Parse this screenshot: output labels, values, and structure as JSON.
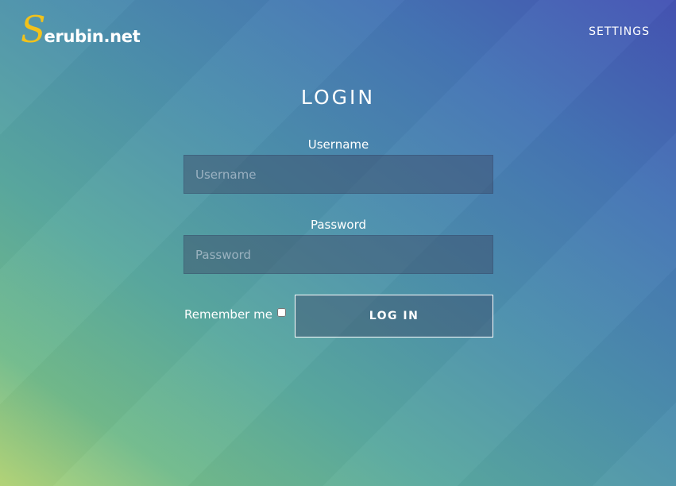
{
  "header": {
    "logo_initial": "S",
    "logo_rest": "erubin.net",
    "settings_label": "SETTINGS"
  },
  "login": {
    "title": "LOGIN",
    "username_label": "Username",
    "username_placeholder": "Username",
    "username_value": "",
    "password_label": "Password",
    "password_placeholder": "Password",
    "password_value": "",
    "remember_label": "Remember me",
    "remember_checked": false,
    "submit_label": "LOG IN"
  },
  "colors": {
    "logo_accent": "#f2c21b",
    "gradient_start": "#b6d779",
    "gradient_end": "#4553b4"
  }
}
